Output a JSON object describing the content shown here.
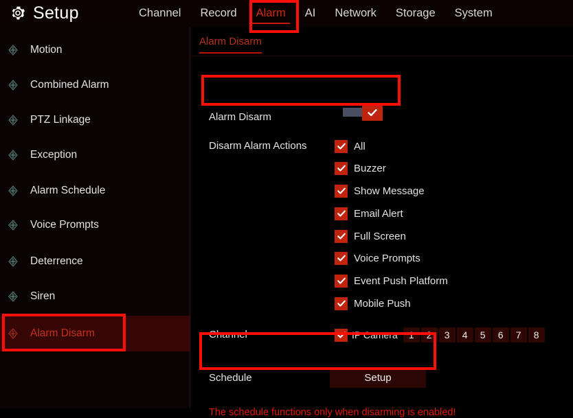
{
  "app": {
    "title": "Setup",
    "gear_icon": "gear-icon"
  },
  "mainnav": {
    "items": [
      {
        "label": "Channel",
        "active": false
      },
      {
        "label": "Record",
        "active": false
      },
      {
        "label": "Alarm",
        "active": true
      },
      {
        "label": "AI",
        "active": false
      },
      {
        "label": "Network",
        "active": false
      },
      {
        "label": "Storage",
        "active": false
      },
      {
        "label": "System",
        "active": false
      }
    ]
  },
  "sidebar": {
    "items": [
      {
        "label": "Motion",
        "icon": "diamond-node-icon",
        "selected": false
      },
      {
        "label": "Combined Alarm",
        "icon": "diamond-node-icon",
        "selected": false
      },
      {
        "label": "PTZ Linkage",
        "icon": "diamond-node-icon",
        "selected": false
      },
      {
        "label": "Exception",
        "icon": "diamond-node-icon",
        "selected": false
      },
      {
        "label": "Alarm Schedule",
        "icon": "diamond-node-icon",
        "selected": false
      },
      {
        "label": "Voice Prompts",
        "icon": "diamond-node-icon",
        "selected": false
      },
      {
        "label": "Deterrence",
        "icon": "diamond-node-icon",
        "selected": false
      },
      {
        "label": "Siren",
        "icon": "diamond-node-icon",
        "selected": false
      },
      {
        "label": "Alarm Disarm",
        "icon": "diamond-node-icon",
        "selected": true
      }
    ]
  },
  "content": {
    "subtab": "Alarm Disarm",
    "alarm_disarm": {
      "label": "Alarm Disarm",
      "toggle_state": "on",
      "toggle_icon": "check-icon"
    },
    "disarm_actions": {
      "label": "Disarm Alarm Actions",
      "items": [
        {
          "label": "All",
          "checked": true,
          "icon": "check-icon"
        },
        {
          "label": "Buzzer",
          "checked": true,
          "icon": "check-icon"
        },
        {
          "label": "Show Message",
          "checked": true,
          "icon": "check-icon"
        },
        {
          "label": "Email Alert",
          "checked": true,
          "icon": "check-icon"
        },
        {
          "label": "Full Screen",
          "checked": true,
          "icon": "check-icon"
        },
        {
          "label": "Voice Prompts",
          "checked": true,
          "icon": "check-icon"
        },
        {
          "label": "Event Push Platform",
          "checked": true,
          "icon": "check-icon"
        },
        {
          "label": "Mobile Push",
          "checked": true,
          "icon": "check-icon"
        }
      ]
    },
    "channel": {
      "label": "Channel",
      "ip_camera_label": "IP Camera",
      "ip_camera_checked": true,
      "numbers": [
        "1",
        "2",
        "3",
        "4",
        "5",
        "6",
        "7",
        "8"
      ]
    },
    "schedule": {
      "label": "Schedule",
      "button_label": "Setup"
    },
    "warning": "The schedule functions only when disarming is enabled!"
  },
  "colors": {
    "accent_red": "#c0240f",
    "annotation_red": "#fb0f06",
    "warning_red": "#e01608",
    "selected_row_bg": "#360505",
    "channel_button_bg": "#2e0604"
  }
}
